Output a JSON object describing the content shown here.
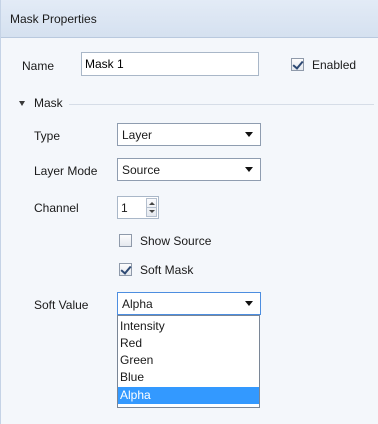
{
  "header": {
    "title": "Mask Properties"
  },
  "name_row": {
    "label": "Name",
    "value": "Mask 1"
  },
  "enabled": {
    "label": "Enabled",
    "checked": true
  },
  "section": {
    "title": "Mask"
  },
  "type": {
    "label": "Type",
    "value": "Layer"
  },
  "layer_mode": {
    "label": "Layer Mode",
    "value": "Source"
  },
  "channel": {
    "label": "Channel",
    "value": "1"
  },
  "show_source": {
    "label": "Show Source",
    "checked": false
  },
  "soft_mask": {
    "label": "Soft Mask",
    "checked": true
  },
  "soft_value": {
    "label": "Soft Value",
    "value": "Alpha",
    "options": [
      "Intensity",
      "Red",
      "Green",
      "Blue",
      "Alpha"
    ],
    "highlighted": "Alpha"
  },
  "icons": {
    "collapse": "triangle-down-icon",
    "dropdown": "chevron-down-icon",
    "spinner": "spinner-arrows-icon",
    "check": "checkmark-icon"
  },
  "colors": {
    "selection": "#3399ff",
    "header_bg": "#dbe5f2",
    "focus_border": "#4d8ee0"
  }
}
